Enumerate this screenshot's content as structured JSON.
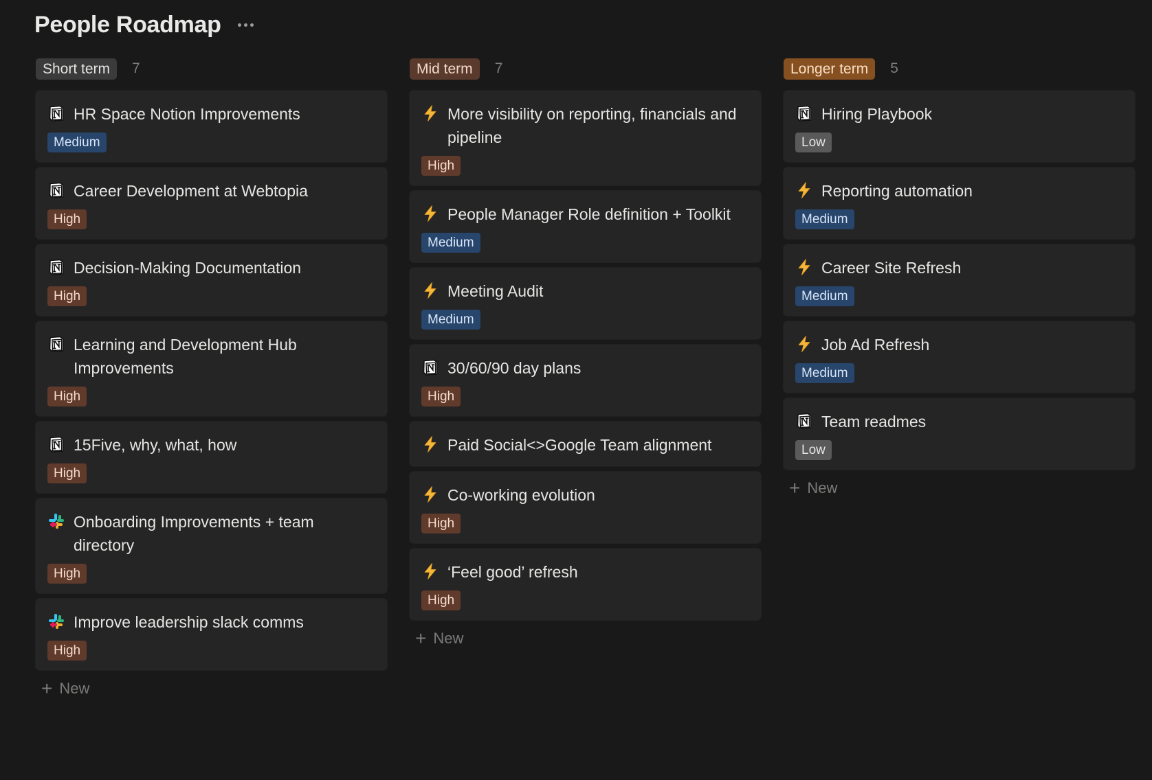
{
  "page": {
    "title": "People Roadmap",
    "more_icon": "more-horizontal-icon"
  },
  "colors": {
    "background": "#191919",
    "card": "#252525",
    "medium_badge": "#28456c",
    "high_badge": "#603b2c",
    "low_badge": "#5a5a5a",
    "short_term_pill": "#3b3b3b",
    "mid_term_pill": "#5a3a2c",
    "longer_term_pill": "#875021"
  },
  "columns": [
    {
      "label": "Short term",
      "count": "7",
      "new_label": "New",
      "cards": [
        {
          "icon": "notion-icon",
          "title": "HR Space Notion Improvements",
          "priority": "Medium"
        },
        {
          "icon": "notion-icon",
          "title": "Career Development at Webtopia",
          "priority": "High"
        },
        {
          "icon": "notion-icon",
          "title": "Decision-Making Documentation",
          "priority": "High"
        },
        {
          "icon": "notion-icon",
          "title": "Learning and Development Hub Improvements",
          "priority": "High"
        },
        {
          "icon": "notion-icon",
          "title": "15Five, why, what, how",
          "priority": "High"
        },
        {
          "icon": "slack-icon",
          "title": "Onboarding Improvements + team directory",
          "priority": "High"
        },
        {
          "icon": "slack-icon",
          "title": "Improve leadership slack comms",
          "priority": "High"
        }
      ]
    },
    {
      "label": "Mid term",
      "count": "7",
      "new_label": "New",
      "cards": [
        {
          "icon": "lightning-icon",
          "title": "More visibility on reporting, financials and pipeline",
          "priority": "High"
        },
        {
          "icon": "lightning-icon",
          "title": "People Manager Role definition + Toolkit",
          "priority": "Medium"
        },
        {
          "icon": "lightning-icon",
          "title": "Meeting Audit",
          "priority": "Medium"
        },
        {
          "icon": "notion-icon",
          "title": "30/60/90 day plans",
          "priority": "High"
        },
        {
          "icon": "lightning-icon",
          "title": "Paid Social<>Google Team alignment",
          "priority": ""
        },
        {
          "icon": "lightning-icon",
          "title": "Co-working evolution",
          "priority": "High"
        },
        {
          "icon": "lightning-icon",
          "title": "‘Feel good’ refresh",
          "priority": "High"
        }
      ]
    },
    {
      "label": "Longer term",
      "count": "5",
      "new_label": "New",
      "cards": [
        {
          "icon": "notion-icon",
          "title": "Hiring Playbook",
          "priority": "Low"
        },
        {
          "icon": "lightning-icon",
          "title": "Reporting automation",
          "priority": "Medium"
        },
        {
          "icon": "lightning-icon",
          "title": "Career Site Refresh",
          "priority": "Medium"
        },
        {
          "icon": "lightning-icon",
          "title": "Job Ad Refresh",
          "priority": "Medium"
        },
        {
          "icon": "notion-icon",
          "title": "Team readmes",
          "priority": "Low"
        }
      ]
    }
  ]
}
